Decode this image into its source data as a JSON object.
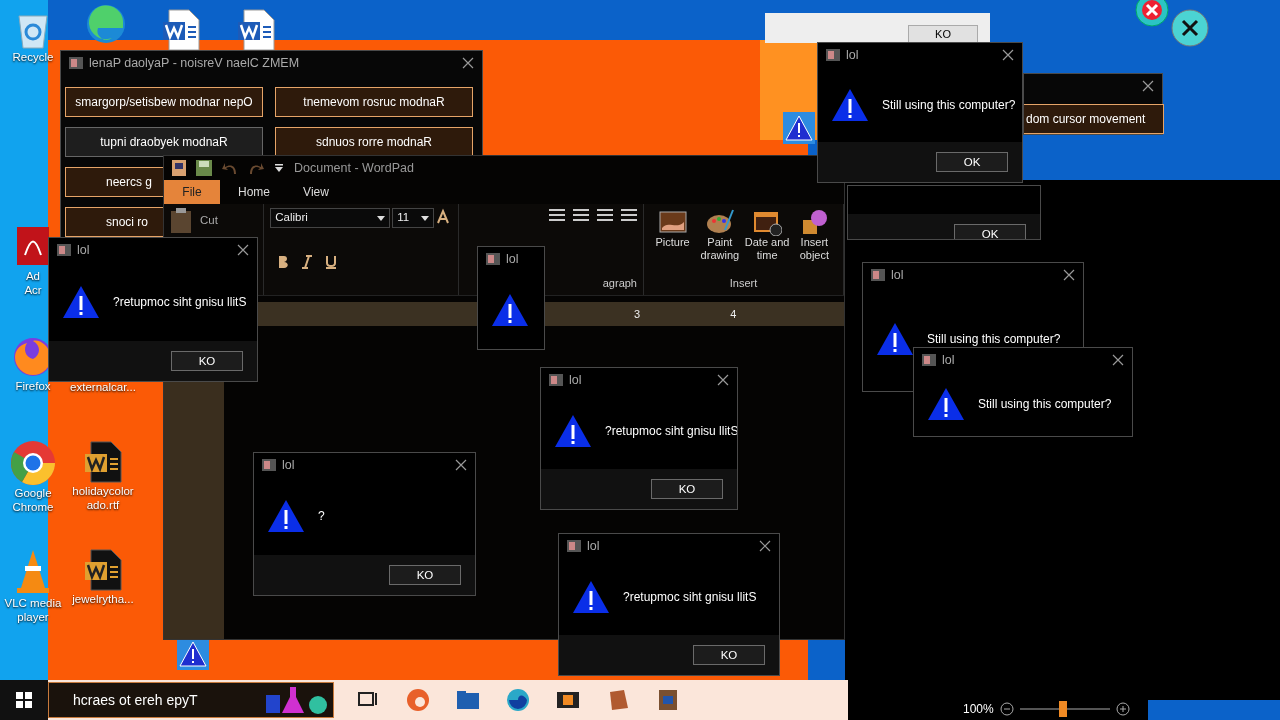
{
  "desktop_icons": [
    {
      "kind": "recycle",
      "label": "Recycle"
    },
    {
      "kind": "edge"
    },
    {
      "kind": "word"
    },
    {
      "kind": "word"
    },
    {
      "kind": "pdf",
      "label": "Ad\nAcr"
    },
    {
      "kind": "firefox",
      "label": "Firefox"
    },
    {
      "kind": "chrome",
      "label": "Google Chrome"
    },
    {
      "kind": "vlc",
      "label": "VLC media player"
    },
    {
      "kind": "none",
      "label": "externalcar..."
    },
    {
      "kind": "word",
      "label": "holidaycolor ado.rtf"
    },
    {
      "kind": "word",
      "label": "jewelrytha..."
    },
    {
      "kind": "warning"
    },
    {
      "kind": "warning"
    }
  ],
  "payload_panel": {
    "title": "lenaP daolyaP - noisreV naelC ZMEM",
    "buttons": [
      {
        "label": "smargorp/setisbew modnar nepO",
        "hovered": false
      },
      {
        "label": "tnemevom rosruc modnaR",
        "hovered": false
      },
      {
        "label": "tupni draobyek modnaR",
        "hovered": true
      },
      {
        "label": "sdnuos rorre modnaR",
        "hovered": false
      },
      {
        "label": "neercs g",
        "hovered": false,
        "kind": "cut"
      },
      {
        "label": "snoci ro",
        "hovered": false,
        "kind": "cut"
      }
    ]
  },
  "payload_panel_2": {
    "buttons": [
      {
        "label": "dom cursor movement",
        "hovered": false
      }
    ]
  },
  "light_window": {
    "button": "KO"
  },
  "wordpad": {
    "title": "Document - WordPad",
    "tabs": [
      {
        "label": "File",
        "selected": true
      },
      {
        "label": "Home",
        "selected": false
      },
      {
        "label": "View",
        "selected": false
      }
    ],
    "clipboard": {
      "cut": "Cut"
    },
    "font": {
      "family": "Calibri",
      "size": "11"
    },
    "paragraph_label": "agraph",
    "insert": {
      "label": "Insert",
      "tools": [
        "Picture",
        "Paint drawing",
        "Date and time",
        "Insert object"
      ]
    },
    "ruler": [
      "3",
      "4"
    ]
  },
  "dialogs": [
    {
      "title": "lol",
      "message": "Still using this computer?",
      "button": "OK"
    },
    {
      "button": "OK"
    },
    {
      "title": "lol",
      "message": "Still using this computer?"
    },
    {
      "title": "lol",
      "message": "Still using this computer?"
    },
    {
      "title": "lol"
    },
    {
      "title": "lol",
      "message": "?retupmoc siht gnisu llitS",
      "button": "KO"
    },
    {
      "title": "lol",
      "message": "?",
      "button": "KO"
    },
    {
      "title": "lol",
      "message": "?retupmoc siht gnisu llitS",
      "button": "KO"
    },
    {
      "title": "lol",
      "message": "?retupmoc siht gnisu llitS",
      "button": "KO"
    }
  ],
  "zoom_bar": {
    "reading": "100%",
    "level": 0.48
  },
  "taskbar": {
    "search": {
      "placeholder": "hcraes ot ereh epyT"
    },
    "apps": [
      {
        "kind": "taskview"
      },
      {
        "kind": "edge"
      },
      {
        "kind": "folder"
      },
      {
        "kind": "firefox"
      },
      {
        "kind": "media"
      },
      {
        "kind": "notebook"
      },
      {
        "kind": "book"
      }
    ]
  }
}
